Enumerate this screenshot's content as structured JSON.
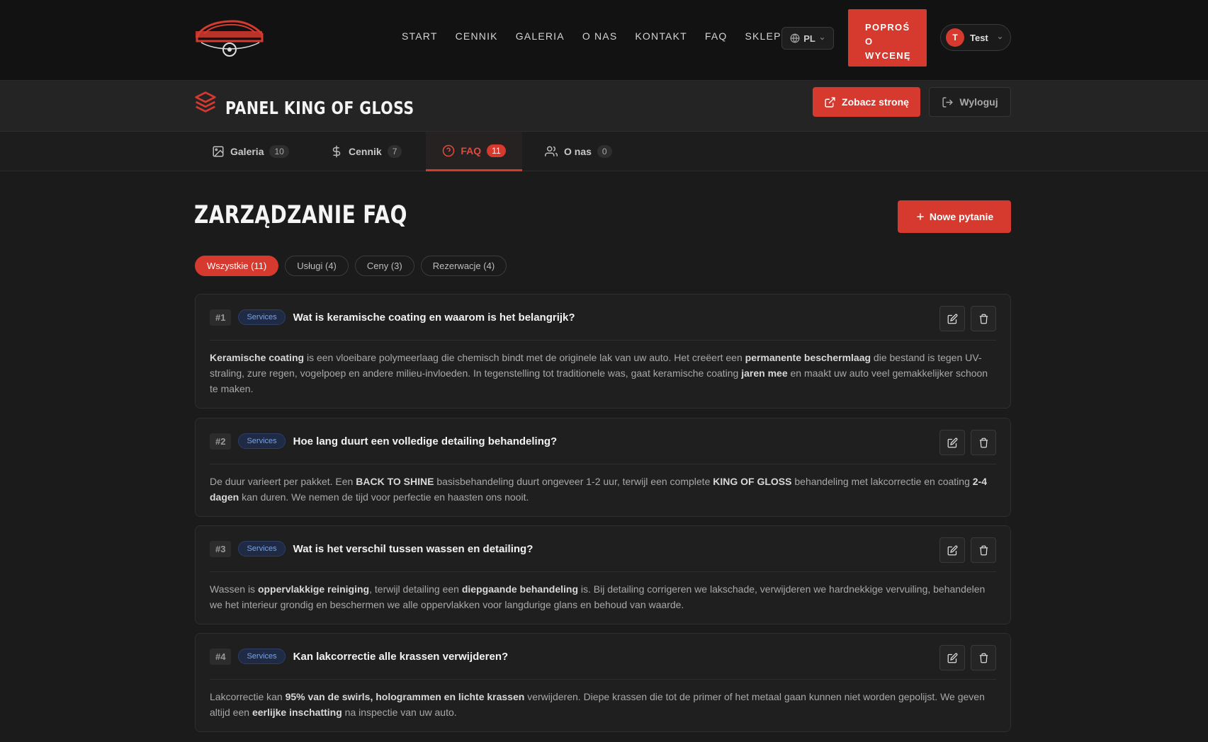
{
  "nav": {
    "links": [
      "START",
      "CENNIK",
      "GALERIA",
      "O NAS",
      "KONTAKT",
      "FAQ",
      "SKLEP"
    ],
    "lang": "PL",
    "quote_lines": [
      "POPROŚ",
      "O",
      "WYCENĘ"
    ],
    "user_initial": "T",
    "user_name": "Test"
  },
  "panel": {
    "title": "PANEL KING OF GLOSS",
    "view_site": "Zobacz stronę",
    "logout": "Wyloguj"
  },
  "tabs": [
    {
      "label": "Galeria",
      "count": "10"
    },
    {
      "label": "Cennik",
      "count": "7"
    },
    {
      "label": "FAQ",
      "count": "11"
    },
    {
      "label": "O nas",
      "count": "0"
    }
  ],
  "section": {
    "title": "ZARZĄDZANIE FAQ",
    "new_button": "Nowe pytanie"
  },
  "filters": [
    "Wszystkie (11)",
    "Usługi (4)",
    "Ceny (3)",
    "Rezerwacje (4)"
  ],
  "faqs": [
    {
      "num": "#1",
      "category": "Services",
      "question": "Wat is keramische coating en waarom is het belangrijk?",
      "answer": [
        {
          "t": "Keramische coating",
          "b": true
        },
        {
          "t": " is een vloeibare polymeerlaag die chemisch bindt met de originele lak van uw auto. Het creëert een "
        },
        {
          "t": "permanente beschermlaag",
          "b": true
        },
        {
          "t": " die bestand is tegen UV-straling, zure regen, vogelpoep en andere milieu-invloeden. In tegenstelling tot traditionele was, gaat keramische coating "
        },
        {
          "t": "jaren mee",
          "b": true
        },
        {
          "t": " en maakt uw auto veel gemakkelijker schoon te maken."
        }
      ]
    },
    {
      "num": "#2",
      "category": "Services",
      "question": "Hoe lang duurt een volledige detailing behandeling?",
      "answer": [
        {
          "t": "De duur varieert per pakket. Een "
        },
        {
          "t": "BACK TO SHINE",
          "b": true
        },
        {
          "t": " basisbehandeling duurt ongeveer 1-2 uur, terwijl een complete "
        },
        {
          "t": "KING OF GLOSS",
          "b": true
        },
        {
          "t": " behandeling met lakcorrectie en coating "
        },
        {
          "t": "2-4 dagen",
          "b": true
        },
        {
          "t": " kan duren. We nemen de tijd voor perfectie en haasten ons nooit."
        }
      ]
    },
    {
      "num": "#3",
      "category": "Services",
      "question": "Wat is het verschil tussen wassen en detailing?",
      "answer": [
        {
          "t": "Wassen is "
        },
        {
          "t": "oppervlakkige reiniging",
          "b": true
        },
        {
          "t": ", terwijl detailing een "
        },
        {
          "t": "diepgaande behandeling",
          "b": true
        },
        {
          "t": " is. Bij detailing corrigeren we lakschade, verwijderen we hardnekkige vervuiling, behandelen we het interieur grondig en beschermen we alle oppervlakken voor langdurige glans en behoud van waarde."
        }
      ]
    },
    {
      "num": "#4",
      "category": "Services",
      "question": "Kan lakcorrectie alle krassen verwijderen?",
      "answer": [
        {
          "t": "Lakcorrectie kan "
        },
        {
          "t": "95% van de swirls, hologrammen en lichte krassen",
          "b": true
        },
        {
          "t": " verwijderen. Diepe krassen die tot de primer of het metaal gaan kunnen niet worden gepolijst. We geven altijd een "
        },
        {
          "t": "eerlijke inschatting",
          "b": true
        },
        {
          "t": " na inspectie van uw auto."
        }
      ]
    }
  ],
  "colors": {
    "accent": "#d63a2f",
    "bg": "#1b1b1b",
    "card": "#1f1f1f"
  }
}
